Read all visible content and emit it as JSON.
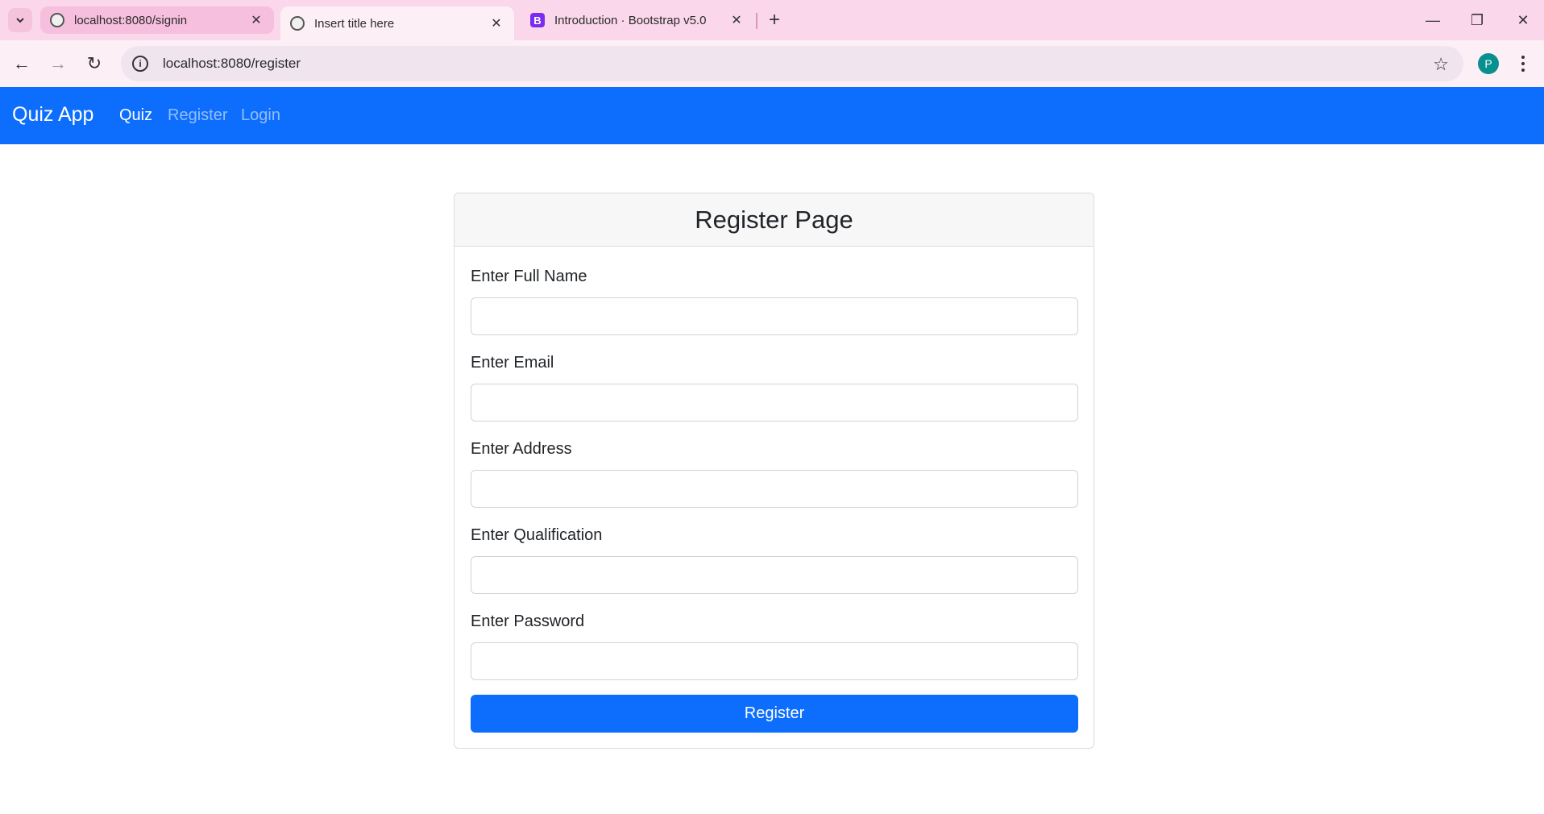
{
  "browser": {
    "tabs": [
      {
        "title": "localhost:8080/signin",
        "icon": "globe-icon"
      },
      {
        "title": "Insert title here",
        "icon": "globe-icon"
      },
      {
        "title": "Introduction · Bootstrap v5.0",
        "icon": "bootstrap-icon",
        "icon_letter": "B"
      }
    ],
    "url": "localhost:8080/register",
    "profile_initial": "P"
  },
  "navbar": {
    "brand": "Quiz App",
    "links": [
      {
        "label": "Quiz"
      },
      {
        "label": "Register"
      },
      {
        "label": "Login"
      }
    ]
  },
  "form": {
    "title": "Register Page",
    "fields": [
      {
        "label": "Enter Full Name",
        "value": ""
      },
      {
        "label": "Enter Email",
        "value": ""
      },
      {
        "label": "Enter Address",
        "value": ""
      },
      {
        "label": "Enter Qualification",
        "value": ""
      },
      {
        "label": "Enter Password",
        "value": ""
      }
    ],
    "submit_label": "Register"
  },
  "colors": {
    "primary": "#0d6efd",
    "tabstrip": "#fad7ea"
  }
}
